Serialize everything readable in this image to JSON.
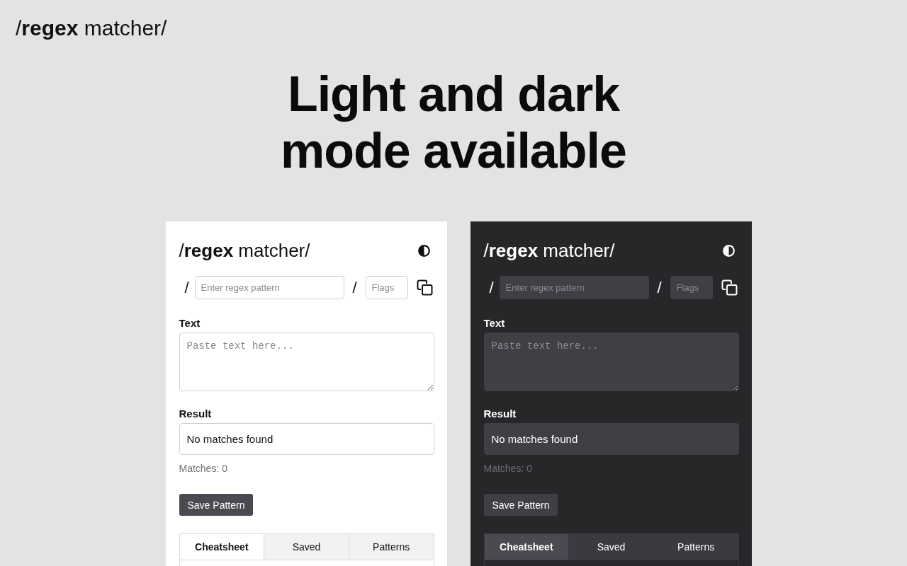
{
  "brand": "/**regex** matcher/",
  "headline_lines": [
    "Light and dark",
    "mode available"
  ],
  "panels": [
    {
      "kind": "light",
      "brand": "/**regex** matcher/",
      "open_delimiter": "/",
      "pattern_placeholder": "Enter regex pattern",
      "close_delimiter": "/",
      "flags_placeholder": "Flags",
      "text_label": "Text",
      "text_placeholder": "Paste text here...",
      "result_label": "Result",
      "result": "No matches found",
      "matches": "Matches: 0",
      "save_button": "Save Pattern",
      "tabs": [
        {
          "label": "Cheatsheet",
          "selected": true
        },
        {
          "label": "Saved",
          "selected": false
        },
        {
          "label": "Patterns",
          "selected": false
        }
      ]
    },
    {
      "kind": "dark",
      "brand": "/**regex** matcher/",
      "open_delimiter": "/",
      "pattern_placeholder": "Enter regex pattern",
      "close_delimiter": "/",
      "flags_placeholder": "Flags",
      "text_label": "Text",
      "text_placeholder": "Paste text here...",
      "result_label": "Result",
      "result": "No matches found",
      "matches": "Matches: 0",
      "save_button": "Save Pattern",
      "tabs": [
        {
          "label": "Cheatsheet",
          "selected": true
        },
        {
          "label": "Saved",
          "selected": false
        },
        {
          "label": "Patterns",
          "selected": false
        }
      ]
    }
  ]
}
